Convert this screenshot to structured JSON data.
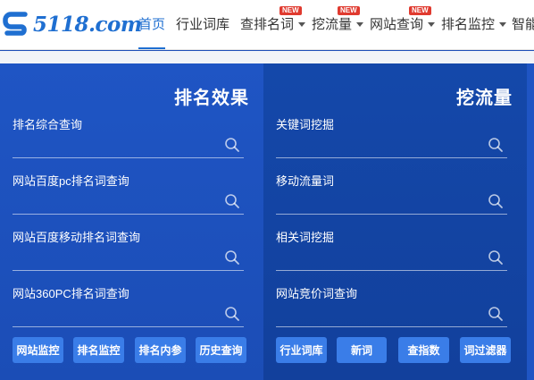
{
  "logo": {
    "text": "5118.com"
  },
  "nav": {
    "items": [
      {
        "label": "首页"
      },
      {
        "label": "行业词库"
      },
      {
        "label": "查排名词",
        "badge": "NEW"
      },
      {
        "label": "挖流量",
        "badge": "NEW"
      },
      {
        "label": "网站查询",
        "badge": "NEW"
      },
      {
        "label": "排名监控"
      },
      {
        "label": "智能"
      }
    ]
  },
  "left_panel": {
    "title": "排名效果",
    "fields": [
      {
        "label": "排名综合查询"
      },
      {
        "label": "网站百度pc排名词查询"
      },
      {
        "label": "网站百度移动排名词查询"
      },
      {
        "label": "网站360PC排名词查询"
      }
    ],
    "buttons": [
      "网站监控",
      "排名监控",
      "排名内参",
      "历史查询"
    ]
  },
  "right_panel": {
    "title": "挖流量",
    "fields": [
      {
        "label": "关键词挖掘"
      },
      {
        "label": "移动流量词"
      },
      {
        "label": "相关词挖掘"
      },
      {
        "label": "网站竞价词查询"
      }
    ],
    "buttons": [
      "行业词库",
      "新词",
      "查指数",
      "词过滤器"
    ]
  },
  "colors": {
    "brand": "#1f6fd1",
    "badge": "#e03a2f",
    "panel_left": "#1f55c4",
    "panel_right": "#1448aa",
    "button": "#3a7de8"
  }
}
